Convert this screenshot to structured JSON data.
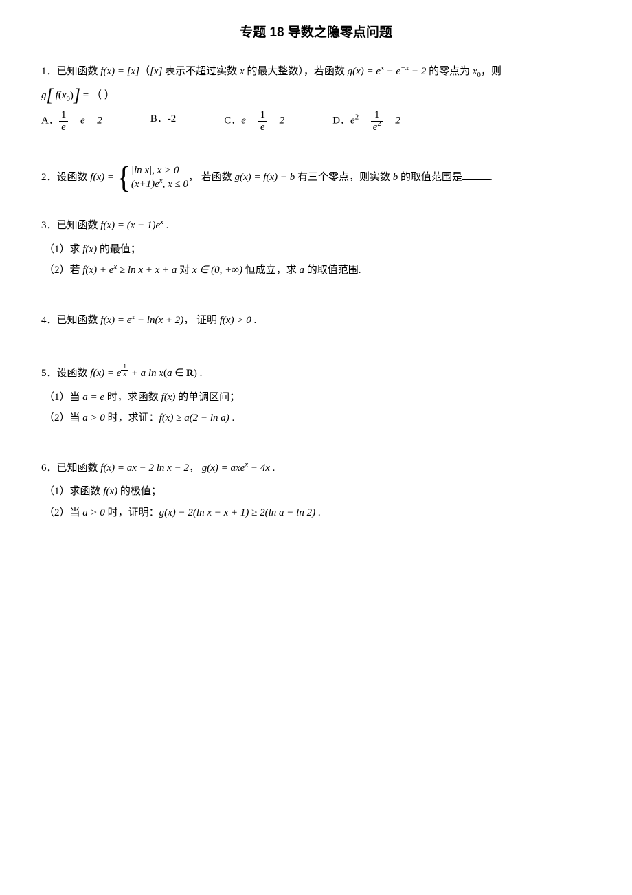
{
  "title": "专题 18   导数之隐零点问题",
  "q1": {
    "n": "1．",
    "t1": "已知函数 ",
    "f1": "f(x) = [x]",
    "t2": "（",
    "f2": "[x]",
    "t3": " 表示不超过实数 ",
    "x": "x",
    "t4": " 的最大整数），若函数 ",
    "g": "g(x) = e",
    "gx": "x",
    "gm": " − e",
    "gmx": "−x",
    "gt": " − 2",
    "t5": " 的零点为 ",
    "x0": "x",
    "x0s": "0",
    "t6": "，则",
    "line2a": "g",
    "line2b": "f",
    "line2c": "x",
    "line2cs": "0",
    "line2d": " = （   ）",
    "a": "A．",
    "b": "B．-2",
    "c": "C．",
    "d": "D．",
    "fa_num": "1",
    "fa_den": "e",
    "fa_tail": " − e − 2",
    "fc_head": "e − ",
    "fc_num": "1",
    "fc_den": "e",
    "fc_tail": " − 2",
    "fd_head": "e",
    "fd_sup": "2",
    "fd_mid": " − ",
    "fd_num": "1",
    "fd_den": "e",
    "fd_densup": "2",
    "fd_tail": " − 2"
  },
  "q2": {
    "n": "2．",
    "t1": "设函数 ",
    "fh": "f(x) = ",
    "row1a": "|ln x|",
    "row1b": ", x > 0",
    "row2a": "(x+1)e",
    "row2ax": "x",
    "row2b": ", x ≤ 0",
    "t2": "， 若函数 ",
    "gh": "g(x) = f(x) − b",
    "t3": " 有三个零点，则实数 ",
    "bv": "b",
    "t4": " 的取值范围是",
    "t5": "."
  },
  "q3": {
    "n": "3．",
    "t1": "已知函数 ",
    "f": "f(x) = (x − 1)e",
    "fx": "x",
    "t2": " .",
    "s1a": "（1）求 ",
    "s1f": "f(x)",
    "s1b": " 的最值；",
    "s2a": "（2）若 ",
    "s2f": "f(x) + e",
    "s2fx": "x",
    "s2m": " ≥ ln x + x + a",
    "s2b": " 对 ",
    "s2r": "x ∈ (0, +∞)",
    "s2c": " 恒成立，求 ",
    "s2v": "a",
    "s2d": " 的取值范围."
  },
  "q4": {
    "n": "4．",
    "t1": "已知函数 ",
    "f": "f(x) = e",
    "fx": "x",
    "fm": " − ln(x + 2)",
    "t2": "， 证明 ",
    "c": "f(x) > 0",
    "t3": " ."
  },
  "q5": {
    "n": "5．",
    "t1": "设函数 ",
    "f": "f(x) = e",
    "exp_num": "1",
    "exp_den": "x",
    "fm": " + a ln x",
    "pa": "(a ∈ R)",
    "t2": " .",
    "s1a": "（1）当 ",
    "s1e": "a = e",
    "s1b": " 时，求函数 ",
    "s1f": "f(x)",
    "s1c": " 的单调区间；",
    "s2a": "（2）当 ",
    "s2e": "a > 0",
    "s2b": " 时，求证：",
    "s2f": "f(x) ≥ a(2 − ln a)",
    "s2c": " ."
  },
  "q6": {
    "n": "6．",
    "t1": "已知函数 ",
    "f": "f(x) = ax − 2 ln x − 2",
    "t2": "， ",
    "g": "g(x) = axe",
    "gx": "x",
    "gm": " − 4x",
    "t3": " .",
    "s1a": "（1）求函数 ",
    "s1f": "f(x)",
    "s1b": " 的极值；",
    "s2a": "（2）当 ",
    "s2e": "a > 0",
    "s2b": " 时，证明：",
    "s2f": "g(x) − 2(ln x − x + 1) ≥ 2(ln a − ln 2)",
    "s2c": " ."
  }
}
